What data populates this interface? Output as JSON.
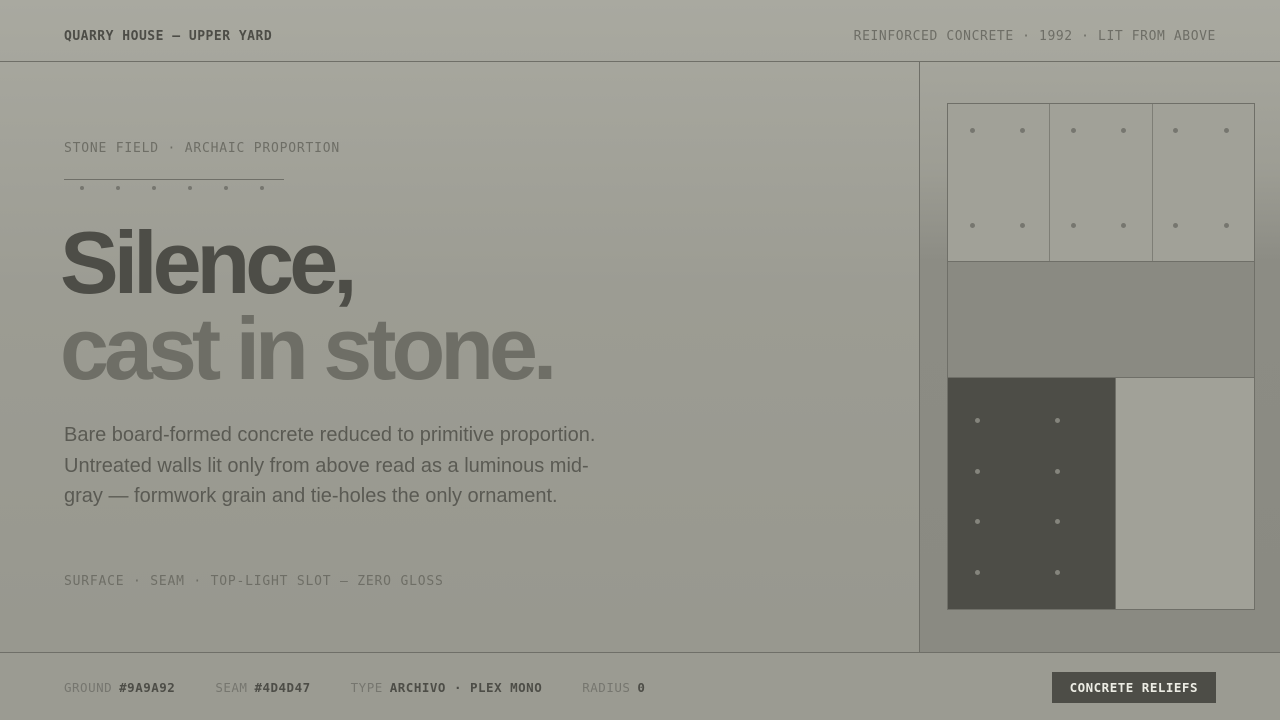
{
  "header": {
    "brand": "QUARRY HOUSE — UPPER YARD",
    "meta": "REINFORCED CONCRETE · 1992 · LIT FROM ABOVE"
  },
  "hero": {
    "eyebrow": "STONE FIELD · ARCHAIC PROPORTION",
    "headline_line1": "Silence,",
    "headline_line2": "cast in stone.",
    "body": "Bare board-formed concrete reduced to primitive proportion. Untreated walls lit only from above read as a luminous mid-gray — formwork grain and tie-holes the only ornament.",
    "tagline": "SURFACE · SEAM · TOP-LIGHT SLOT — ZERO GLOSS"
  },
  "footer": {
    "specs": [
      {
        "label": "GROUND",
        "value": "#9A9A92"
      },
      {
        "label": "SEAM",
        "value": "#4D4D47"
      },
      {
        "label": "TYPE",
        "value": "ARCHIVO · PLEX MONO"
      },
      {
        "label": "RADIUS",
        "value": "0"
      }
    ],
    "cta_label": "CONCRETE RELIEFS"
  },
  "colors": {
    "ground": "#9A9A92",
    "seam": "#4D4D47",
    "muted": "#6E6E66",
    "panel": "#8A8A82"
  }
}
